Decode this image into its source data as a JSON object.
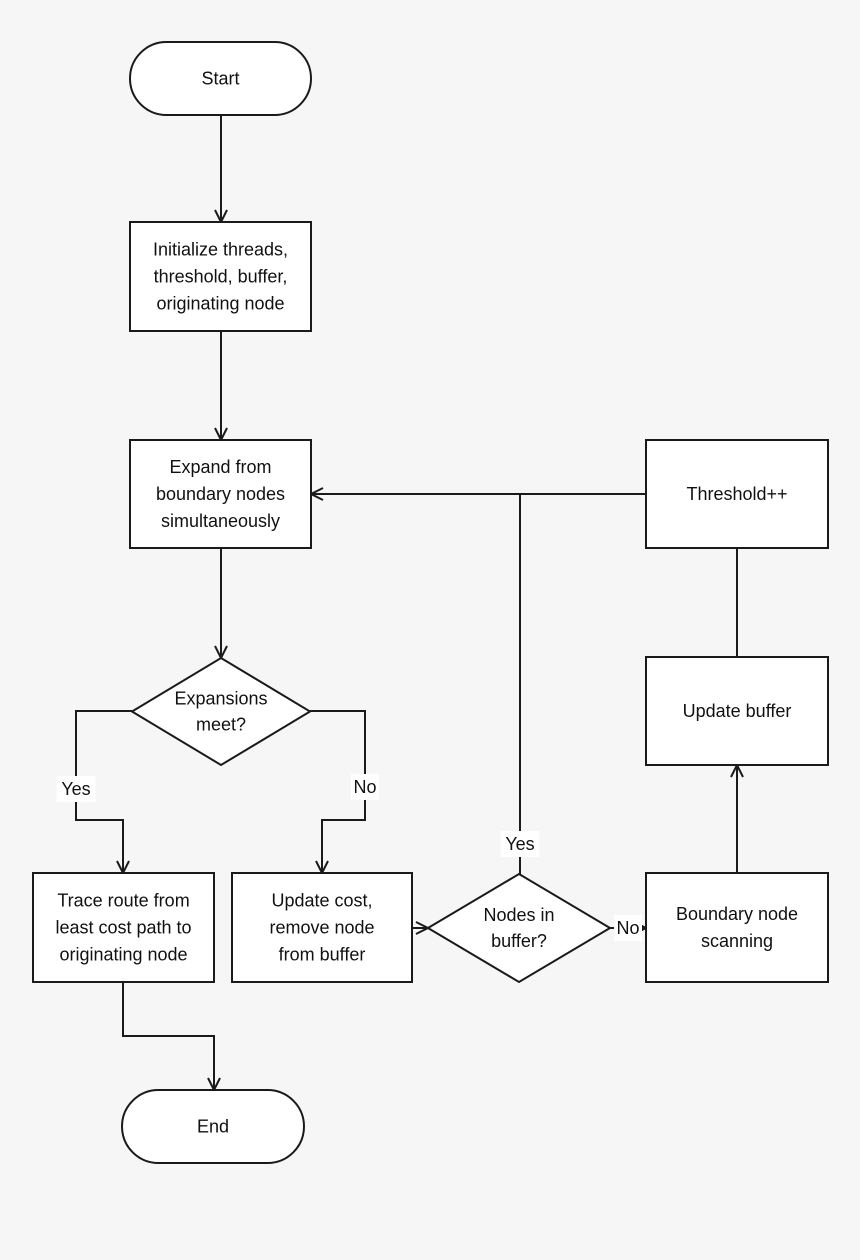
{
  "diagram": {
    "type": "flowchart",
    "background_color": "#f6f6f6",
    "nodes": [
      {
        "id": "start",
        "kind": "terminal",
        "lines": [
          "Start"
        ]
      },
      {
        "id": "init",
        "kind": "process",
        "lines": [
          "Initialize threads,",
          "threshold, buffer,",
          "originating node"
        ]
      },
      {
        "id": "expand",
        "kind": "process",
        "lines": [
          "Expand from",
          "boundary nodes",
          "simultaneously"
        ]
      },
      {
        "id": "meet",
        "kind": "decision",
        "lines": [
          "Expansions",
          "meet?"
        ]
      },
      {
        "id": "trace",
        "kind": "process",
        "lines": [
          "Trace route from",
          "least cost path to",
          "originating node"
        ]
      },
      {
        "id": "update_cost",
        "kind": "process",
        "lines": [
          "Update cost,",
          "remove node",
          "from buffer"
        ]
      },
      {
        "id": "nodes_in_buffer",
        "kind": "decision",
        "lines": [
          "Nodes in",
          "buffer?"
        ]
      },
      {
        "id": "scan",
        "kind": "process",
        "lines": [
          "Boundary node",
          "scanning"
        ]
      },
      {
        "id": "update_buffer",
        "kind": "process",
        "lines": [
          "Update buffer"
        ]
      },
      {
        "id": "threshold",
        "kind": "process",
        "lines": [
          "Threshold++"
        ]
      },
      {
        "id": "end",
        "kind": "terminal",
        "lines": [
          "End"
        ]
      }
    ],
    "edges": [
      {
        "id": "start-init",
        "from": "start",
        "to": "init",
        "label": ""
      },
      {
        "id": "init-expand",
        "from": "init",
        "to": "expand",
        "label": ""
      },
      {
        "id": "expand-meet",
        "from": "expand",
        "to": "meet",
        "label": ""
      },
      {
        "id": "meet-trace",
        "from": "meet",
        "to": "trace",
        "label": "Yes"
      },
      {
        "id": "meet-update-cost",
        "from": "meet",
        "to": "update_cost",
        "label": "No"
      },
      {
        "id": "update-cost-nodes",
        "from": "update_cost",
        "to": "nodes_in_buffer",
        "label": ""
      },
      {
        "id": "nodes-expand",
        "from": "nodes_in_buffer",
        "to": "expand",
        "label": "Yes"
      },
      {
        "id": "nodes-scan",
        "from": "nodes_in_buffer",
        "to": "scan",
        "label": "No"
      },
      {
        "id": "scan-update-buffer",
        "from": "scan",
        "to": "update_buffer",
        "label": ""
      },
      {
        "id": "update-buffer-threshold",
        "from": "update_buffer",
        "to": "threshold",
        "label": ""
      },
      {
        "id": "threshold-expand",
        "from": "threshold",
        "to": "expand",
        "label": ""
      },
      {
        "id": "trace-end",
        "from": "trace",
        "to": "end",
        "label": ""
      }
    ]
  }
}
